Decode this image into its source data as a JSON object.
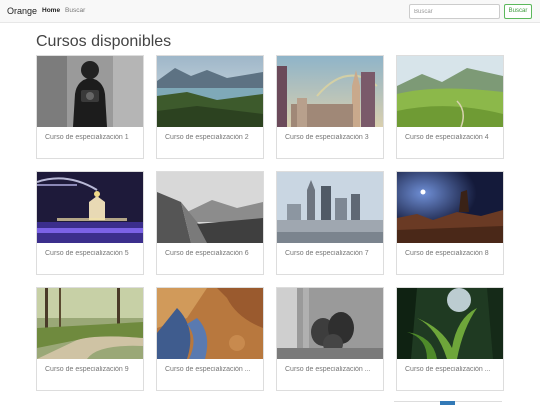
{
  "navbar": {
    "brand": "Orange",
    "links": [
      "Home",
      "Buscar"
    ],
    "search_placeholder": "Buscar",
    "search_button": "Buscar"
  },
  "page_title": "Cursos disponibles",
  "courses": [
    {
      "title": "Curso de especialización 1",
      "image": "photographer-camera-photo"
    },
    {
      "title": "Curso de especialización 2",
      "image": "mountain-lake-photo"
    },
    {
      "title": "Curso de especialización 3",
      "image": "city-rainbow-photo"
    },
    {
      "title": "Curso de especialización 4",
      "image": "green-hills-photo"
    },
    {
      "title": "Curso de especialización 5",
      "image": "night-bridge-cathedral-photo"
    },
    {
      "title": "Curso de especialización 6",
      "image": "gray-cliffs-photo"
    },
    {
      "title": "Curso de especialización 7",
      "image": "city-skyline-photo"
    },
    {
      "title": "Curso de especialización 8",
      "image": "desert-night-sky-photo"
    },
    {
      "title": "Curso de especialización 9",
      "image": "forest-path-photo"
    },
    {
      "title": "Curso de especialización ...",
      "image": "mars-terrain-photo"
    },
    {
      "title": "Curso de especialización ...",
      "image": "pine-cones-photo"
    },
    {
      "title": "Curso de especialización ...",
      "image": "jungle-fern-photo"
    }
  ]
}
